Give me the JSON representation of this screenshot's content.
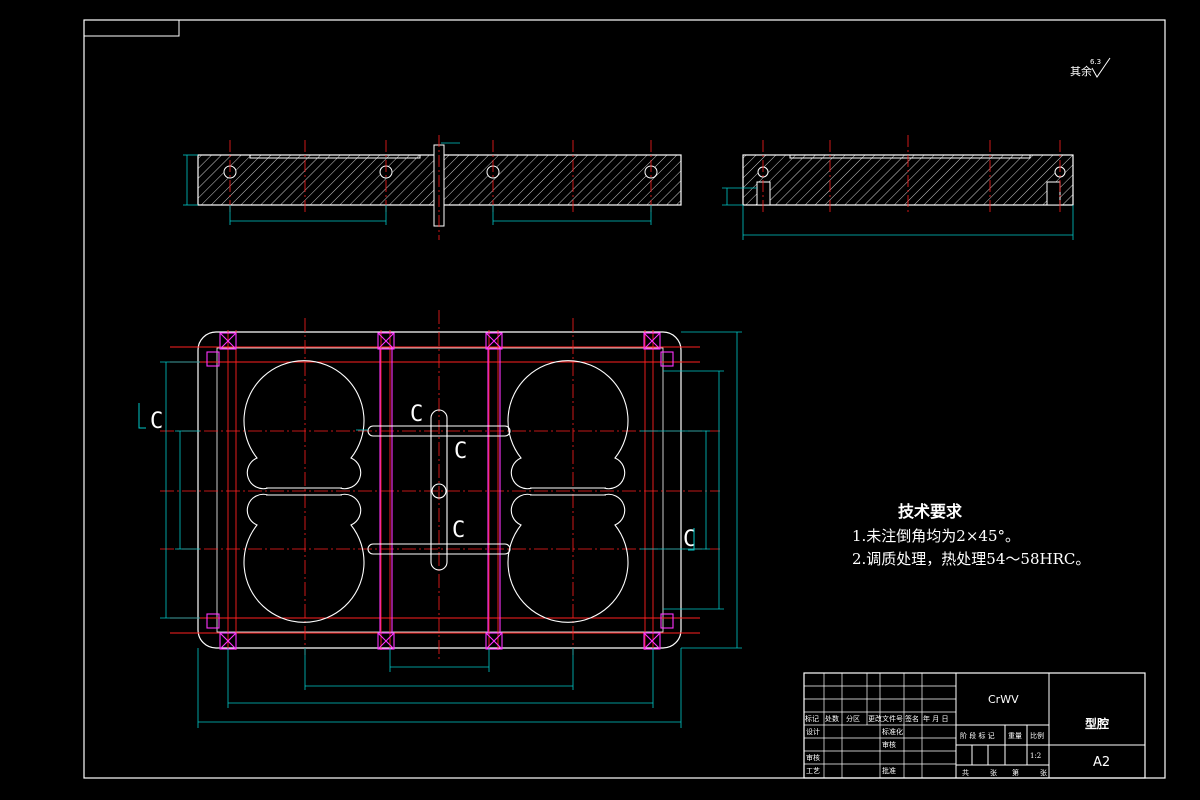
{
  "drawing": {
    "surface_note": "其余",
    "surface_value": "6.3",
    "section_letter": "C",
    "tech_title": "技术要求",
    "tech_req_1": "1.未注倒角均为2×45°。",
    "tech_req_2": "2.调质处理，热处理54～58HRC。"
  },
  "title_block": {
    "material": "CrWV",
    "part_name": "型腔",
    "sheet_size": "A2",
    "row_labels": [
      "标记",
      "处数",
      "分区",
      "更改文件号",
      "签名",
      "年 月 日"
    ],
    "design": "设计",
    "standardize": "标准化",
    "review": "审核",
    "process": "工艺",
    "approve": "批准",
    "check": "审核",
    "scale_ratio": "1:2",
    "stage_labels": [
      "阶 段 标 记",
      "重量",
      "比例"
    ],
    "sheet_labels": [
      "共",
      "张",
      "第",
      "张"
    ]
  },
  "colors": {
    "outline": "#ffffff",
    "hatch": "#ffffff",
    "center": "#ff2020",
    "dimension": "#00c8c8",
    "hidden": "#ff33ff"
  }
}
